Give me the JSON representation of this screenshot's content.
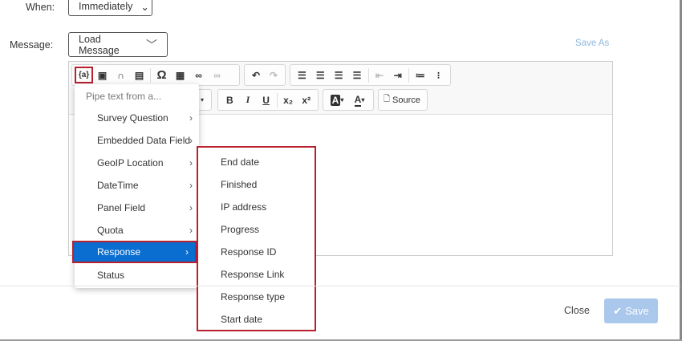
{
  "when": {
    "label": "When:",
    "value": "Immediately"
  },
  "message": {
    "label": "Message:",
    "load_button": "Load Message",
    "save_as": "Save As"
  },
  "toolbar": {
    "row1": [
      "piped-text-icon",
      "image-icon",
      "page-break-icon",
      "media-icon",
      "special-char-icon",
      "table-icon",
      "link-icon",
      "unlink-icon",
      "undo-icon",
      "redo-icon",
      "align-left-icon",
      "align-center-icon",
      "align-right-icon",
      "justify-icon",
      "outdent-icon",
      "indent-icon",
      "numbered-list-icon",
      "bulleted-list-icon"
    ],
    "pipe_label": "{a}",
    "bold": "B",
    "italic": "I",
    "underline": "U",
    "subscript": "x₂",
    "superscript": "x²",
    "bg_color": "A",
    "text_color": "A",
    "source": "Source"
  },
  "pipe_menu": {
    "header": "Pipe text from a...",
    "items": [
      {
        "label": "Survey Question",
        "submenu": true
      },
      {
        "label": "Embedded Data Field",
        "submenu": true
      },
      {
        "label": "GeoIP Location",
        "submenu": true
      },
      {
        "label": "DateTime",
        "submenu": true
      },
      {
        "label": "Panel Field",
        "submenu": true
      },
      {
        "label": "Quota",
        "submenu": true
      },
      {
        "label": "Response",
        "submenu": true,
        "active": true
      },
      {
        "label": "Status",
        "submenu": false
      }
    ]
  },
  "response_submenu": [
    "End date",
    "Finished",
    "IP address",
    "Progress",
    "Response ID",
    "Response Link",
    "Response type",
    "Start date"
  ],
  "footer": {
    "close": "Close",
    "save": "Save"
  },
  "colors": {
    "highlight": "#0a6ed1",
    "annotation": "#b8202e",
    "save_disabled": "#a9c8ec",
    "link": "#8fb8e0"
  }
}
